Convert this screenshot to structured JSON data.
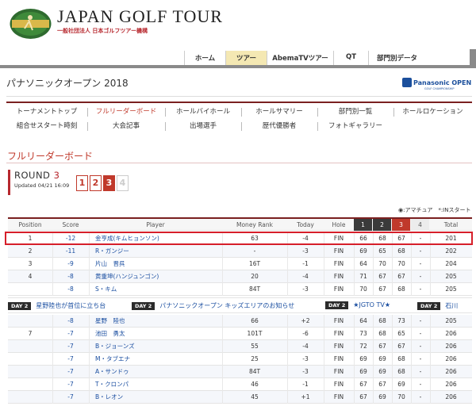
{
  "site": {
    "title": "JAPAN GOLF TOUR",
    "subtitle": "一般社団法人 日本ゴルフツアー機構"
  },
  "global_nav": [
    {
      "label": "ホーム",
      "active": false
    },
    {
      "label": "ツアー",
      "active": true
    },
    {
      "label": "AbemaTVツアー",
      "active": false
    },
    {
      "label": "QT",
      "active": false
    },
    {
      "label": "部門別データ",
      "active": false
    }
  ],
  "event": {
    "title": "パナソニックオープン 2018",
    "sponsor": "Panasonic OPEN",
    "sponsor_sub": "GOLF CHAMPIONSHIP"
  },
  "sub_nav": {
    "row1": [
      "トーナメントトップ",
      "フルリーダーボード",
      "ホールバイホール",
      "ホールサマリー",
      "部門別一覧",
      "ホールロケーション"
    ],
    "row2": [
      "組合せスタート時刻",
      "大会記事",
      "出場選手",
      "歴代優勝者",
      "フォトギャラリー"
    ],
    "active": "フルリーダーボード"
  },
  "section_title": "フルリーダーボード",
  "round": {
    "label": "ROUND",
    "number": "3",
    "updated": "Updated 04/21 16:09",
    "buttons": [
      "1",
      "2",
      "3",
      "4"
    ],
    "active": "3"
  },
  "legend": "◉:アマチュア　*:INスタート",
  "table": {
    "headers": [
      "Position",
      "Score",
      "Player",
      "Money Rank",
      "Today",
      "Hole",
      "1",
      "2",
      "3",
      "4",
      "Total"
    ],
    "rows": [
      {
        "pos": "1",
        "score": "-12",
        "player": "金亨成(キムヒョンソン)",
        "money": "63",
        "today": "-4",
        "hole": "FIN",
        "r1": "66",
        "r2": "68",
        "r3": "67",
        "r4": "-",
        "total": "201"
      },
      {
        "pos": "2",
        "score": "-11",
        "player": "R・ガンジー",
        "money": "-",
        "today": "-3",
        "hole": "FIN",
        "r1": "69",
        "r2": "65",
        "r3": "68",
        "r4": "-",
        "total": "202"
      },
      {
        "pos": "3",
        "score": "-9",
        "player": "片山　晋呉",
        "money": "16T",
        "today": "-1",
        "hole": "FIN",
        "r1": "64",
        "r2": "70",
        "r3": "70",
        "r4": "-",
        "total": "204"
      },
      {
        "pos": "4",
        "score": "-8",
        "player": "黄重坤(ハンジュンゴン)",
        "money": "20",
        "today": "-4",
        "hole": "FIN",
        "r1": "71",
        "r2": "67",
        "r3": "67",
        "r4": "-",
        "total": "205"
      },
      {
        "pos": "",
        "score": "-8",
        "player": "S・キム",
        "money": "84T",
        "today": "-3",
        "hole": "FIN",
        "r1": "70",
        "r2": "67",
        "r3": "68",
        "r4": "-",
        "total": "205"
      },
      {
        "pos": "",
        "score": "-8",
        "player": "星野　陸也",
        "money": "66",
        "today": "+2",
        "hole": "FIN",
        "r1": "64",
        "r2": "68",
        "r3": "73",
        "r4": "-",
        "total": "205"
      },
      {
        "pos": "7",
        "score": "-7",
        "player": "池田　勇太",
        "money": "101T",
        "today": "-6",
        "hole": "FIN",
        "r1": "73",
        "r2": "68",
        "r3": "65",
        "r4": "-",
        "total": "206"
      },
      {
        "pos": "",
        "score": "-7",
        "player": "B・ジョーンズ",
        "money": "55",
        "today": "-4",
        "hole": "FIN",
        "r1": "72",
        "r2": "67",
        "r3": "67",
        "r4": "-",
        "total": "206"
      },
      {
        "pos": "",
        "score": "-7",
        "player": "M・タブエナ",
        "money": "25",
        "today": "-3",
        "hole": "FIN",
        "r1": "69",
        "r2": "69",
        "r3": "68",
        "r4": "-",
        "total": "206"
      },
      {
        "pos": "",
        "score": "-7",
        "player": "A・サンドゥ",
        "money": "84T",
        "today": "-3",
        "hole": "FIN",
        "r1": "69",
        "r2": "69",
        "r3": "68",
        "r4": "-",
        "total": "206"
      },
      {
        "pos": "",
        "score": "-7",
        "player": "T・クロンパ",
        "money": "46",
        "today": "-1",
        "hole": "FIN",
        "r1": "67",
        "r2": "67",
        "r3": "69",
        "r4": "-",
        "total": "206"
      },
      {
        "pos": "",
        "score": "-7",
        "player": "B・レオン",
        "money": "45",
        "today": "+1",
        "hole": "FIN",
        "r1": "67",
        "r2": "69",
        "r3": "70",
        "r4": "-",
        "total": "206"
      }
    ]
  },
  "ticker": [
    {
      "badge": "DAY 2",
      "text": "星野陸也が首位に立ち台"
    },
    {
      "badge": "DAY 2",
      "text": "パナソニックオープン キッズエリアのお知らせ"
    },
    {
      "badge": "DAY 2",
      "text": "★JGTO TV★"
    },
    {
      "badge": "DAY 2",
      "text": "石川"
    }
  ],
  "colors": {
    "accent": "#c0392b",
    "nav_active": "#f4e8b3",
    "link": "#1a4ea0",
    "highlight": "#d61f2a"
  }
}
